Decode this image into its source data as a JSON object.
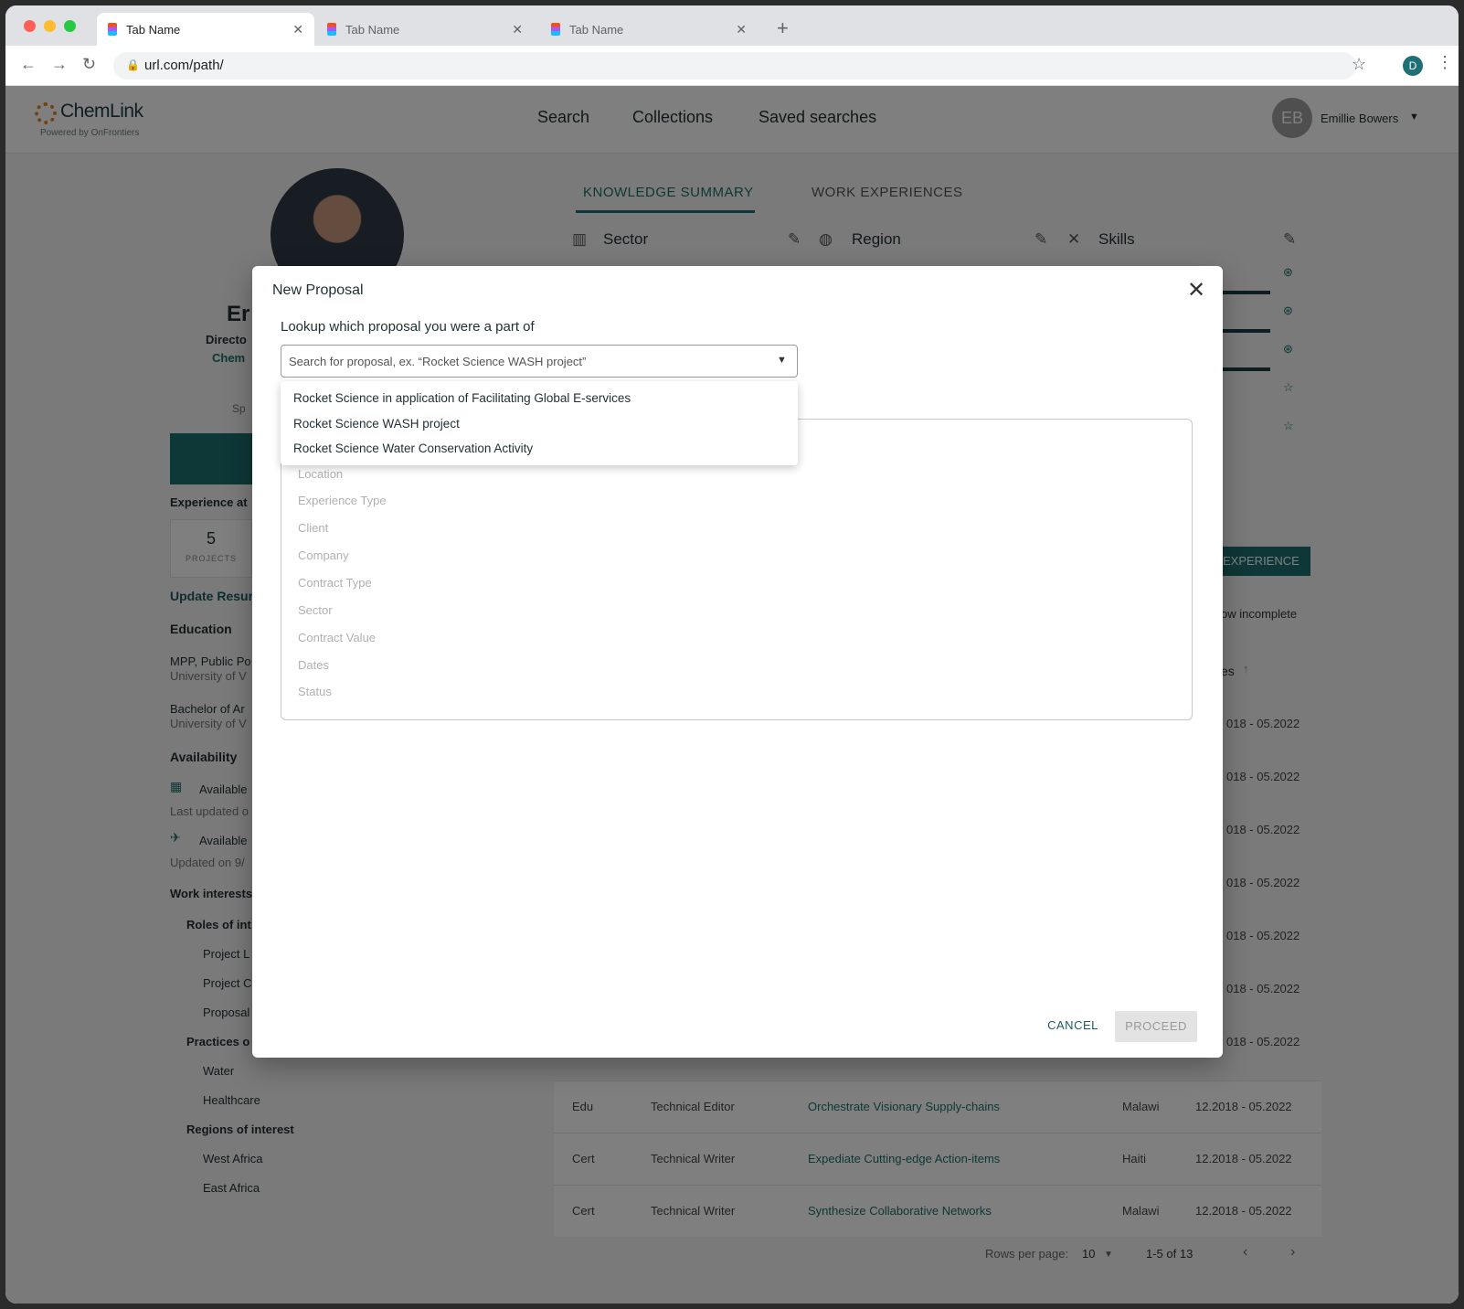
{
  "browser": {
    "tabs": [
      {
        "label": "Tab Name"
      },
      {
        "label": "Tab Name"
      },
      {
        "label": "Tab Name"
      }
    ],
    "new_tab": "+",
    "url": "url.com/path/",
    "profile_initial": "D"
  },
  "header": {
    "logo_name": "ChemLink",
    "logo_sub": "Powered by OnFrontiers",
    "nav": [
      "Search",
      "Collections",
      "Saved searches"
    ],
    "avatar_initials": "EB",
    "user_name": "Emillie Bowers"
  },
  "profile": {
    "name_partial": "Er",
    "title_partial": "Directo",
    "company_partial": "Chem",
    "sp_partial": "Sp",
    "experience_label": "Experience at",
    "stat_value": "5",
    "stat_label": "PROJECTS",
    "update_resume": "Update Resum",
    "education_label": "Education",
    "edu1_degree": "MPP, Public Po",
    "edu1_school": "University of V",
    "edu2_degree": "Bachelor of Ar",
    "edu2_school": "University of V",
    "availability_label": "Availability",
    "avail1": "Available",
    "avail1_updated": "Last updated o",
    "avail2": "Available",
    "avail2_updated": "Updated on 9/",
    "work_interests": "Work interests",
    "roles_label": "Roles of int",
    "roles": [
      "Project L",
      "Project C",
      "Proposal"
    ],
    "practices_label": "Practices o",
    "practices": [
      "Water",
      "Healthcare"
    ],
    "regions_label": "Regions of interest",
    "regions": [
      "West Africa",
      "East Africa"
    ]
  },
  "right": {
    "tab_knowledge": "KNOWLEDGE SUMMARY",
    "tab_work": "WORK EXPERIENCES",
    "sector": "Sector",
    "region": "Region",
    "skills": "Skills",
    "exp_button": "EXPERIENCE",
    "show_incomplete": "ow incomplete",
    "dates_header": "es",
    "date_range": "018 - 05.2022",
    "rows": [
      {
        "type": "Edu",
        "role": "Technical Editor",
        "project": "Orchestrate Visionary Supply-chains",
        "country": "Malawi",
        "dates": "12.2018 - 05.2022"
      },
      {
        "type": "Cert",
        "role": "Technical Writer",
        "project": "Expediate Cutting-edge Action-items",
        "country": "Haiti",
        "dates": "12.2018 - 05.2022"
      },
      {
        "type": "Cert",
        "role": "Technical Writer",
        "project": "Synthesize Collaborative Networks",
        "country": "Malawi",
        "dates": "12.2018 - 05.2022"
      }
    ],
    "pager": {
      "rows_label": "Rows per page:",
      "rows_value": "10",
      "range": "1-5 of 13"
    }
  },
  "modal": {
    "title": "New Proposal",
    "lookup_label": "Lookup which proposal you were a part of",
    "search_placeholder": "Search for proposal, ex. “Rocket Science WASH project”",
    "options": [
      "Rocket Science in application of Facilitating Global E-services",
      "Rocket Science WASH project",
      "Rocket Science Water Conservation Activity"
    ],
    "fields": [
      "Location",
      "Experience Type",
      "Client",
      "Company",
      "Contract Type",
      "Sector",
      "Contract Value",
      "Dates",
      "Status"
    ],
    "cancel": "CANCEL",
    "proceed": "PROCEED"
  }
}
